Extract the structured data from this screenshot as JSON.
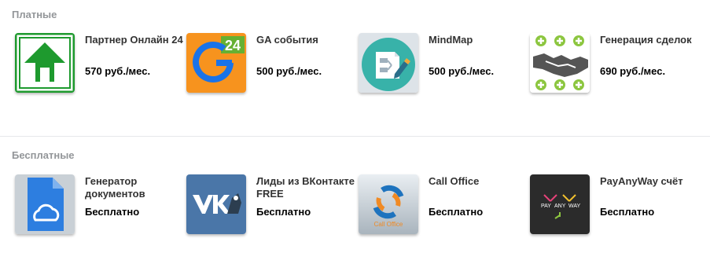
{
  "sections": {
    "paid": {
      "title": "Платные",
      "apps": [
        {
          "name": "Партнер Онлайн 24",
          "price": "570 руб./мес."
        },
        {
          "name": "GA события",
          "price": "500 руб./мес.",
          "icon_text": "24"
        },
        {
          "name": "MindMap",
          "price": "500 руб./мес."
        },
        {
          "name": "Генерация сделок",
          "price": "690 руб./мес."
        }
      ]
    },
    "free": {
      "title": "Бесплатные",
      "apps": [
        {
          "name": "Генератор документов",
          "price": "Бесплатно"
        },
        {
          "name": "Лиды из ВКонтакте FREE",
          "price": "Бесплатно"
        },
        {
          "name": "Call Office",
          "price": "Бесплатно",
          "icon_text": "Call Office"
        },
        {
          "name": "PayAnyWay счёт",
          "price": "Бесплатно",
          "icon_text": [
            "PAY",
            "ANY",
            "WAY"
          ]
        }
      ]
    }
  },
  "colors": {
    "partner_green": "#1e9a2e",
    "ga_orange": "#f7931e",
    "ga_green": "#66b032",
    "mindmap_teal": "#38b2a9",
    "deals_green": "#8cc63f",
    "docs_blue": "#2d7ee0",
    "vk_blue": "#4a76a8",
    "call_blue": "#1e73be",
    "payanyway_dark": "#2b2b2b"
  },
  "icons": [
    "upload-arrow-icon",
    "ga-events-icon",
    "mindmap-icon",
    "handshake-icon",
    "document-cloud-icon",
    "vk-logo-icon",
    "call-office-icon",
    "payanyway-icon"
  ]
}
